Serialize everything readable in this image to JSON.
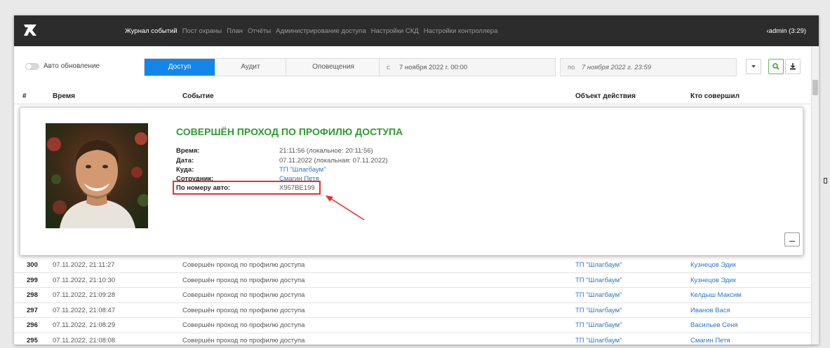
{
  "header": {
    "nav": [
      "Журнал событий",
      "Пост охраны",
      "План",
      "Отчёты",
      "Администрирование доступа",
      "Настройки СКД",
      "Настройки контроллера"
    ],
    "active_nav": 0,
    "user": "admin (3:29)"
  },
  "filters": {
    "auto_update_label": "Авто обновление",
    "tabs": [
      "Доступ",
      "Аудит",
      "Оповещения"
    ],
    "from_prefix": "с",
    "from_value": "7 ноября 2022 г. 00:00",
    "to_prefix": "по",
    "to_value": "7 ноября 2022 г. 23:59"
  },
  "table_headers": {
    "num": "#",
    "time": "Время",
    "event": "Событие",
    "object": "Объект действия",
    "actor": "Кто совершил"
  },
  "detail": {
    "title": "СОВЕРШЁН ПРОХОД ПО ПРОФИЛЮ ДОСТУПА",
    "fields": [
      {
        "key": "Время:",
        "value": "21:11:56 (локальное: 20:11:56)"
      },
      {
        "key": "Дата:",
        "value": "07.11.2022 (локальная: 07.11.2022)"
      },
      {
        "key": "Куда:",
        "value": "ТП \"Шлагбаум\""
      },
      {
        "key": "Сотрудник:",
        "value": "Смагин Петя"
      },
      {
        "key": "По номеру авто:",
        "value": "Х957ВЕ199"
      }
    ]
  },
  "rows": [
    {
      "num": "300",
      "time": "07.11.2022, 21:11:27",
      "event": "Совершён проход по профилю доступа",
      "object": "ТП \"Шлагбаум\"",
      "actor": "Кузнецов Эдик"
    },
    {
      "num": "299",
      "time": "07.11.2022, 21:10:30",
      "event": "Совершён проход по профилю доступа",
      "object": "ТП \"Шлагбаум\"",
      "actor": "Кузнецов Эдик"
    },
    {
      "num": "298",
      "time": "07.11.2022, 21:09:28",
      "event": "Совершён проход по профилю доступа",
      "object": "ТП \"Шлагбаум\"",
      "actor": "Келдыш Максим"
    },
    {
      "num": "297",
      "time": "07.11.2022, 21:08:47",
      "event": "Совершён проход по профилю доступа",
      "object": "ТП \"Шлагбаум\"",
      "actor": "Иванов Вася"
    },
    {
      "num": "296",
      "time": "07.11.2022, 21:08:29",
      "event": "Совершён проход по профилю доступа",
      "object": "ТП \"Шлагбаум\"",
      "actor": "Васильев Сеня"
    },
    {
      "num": "295",
      "time": "07.11.2022, 21:08:08",
      "event": "Совершён проход по профилю доступа",
      "object": "ТП \"Шлагбаум\"",
      "actor": "Смагин Петя"
    }
  ],
  "colors": {
    "accent": "#1586e9",
    "event_title": "#2d9b2d",
    "link": "#2a77c9",
    "highlight": "#e53030",
    "topbar": "#2c2c2c"
  }
}
